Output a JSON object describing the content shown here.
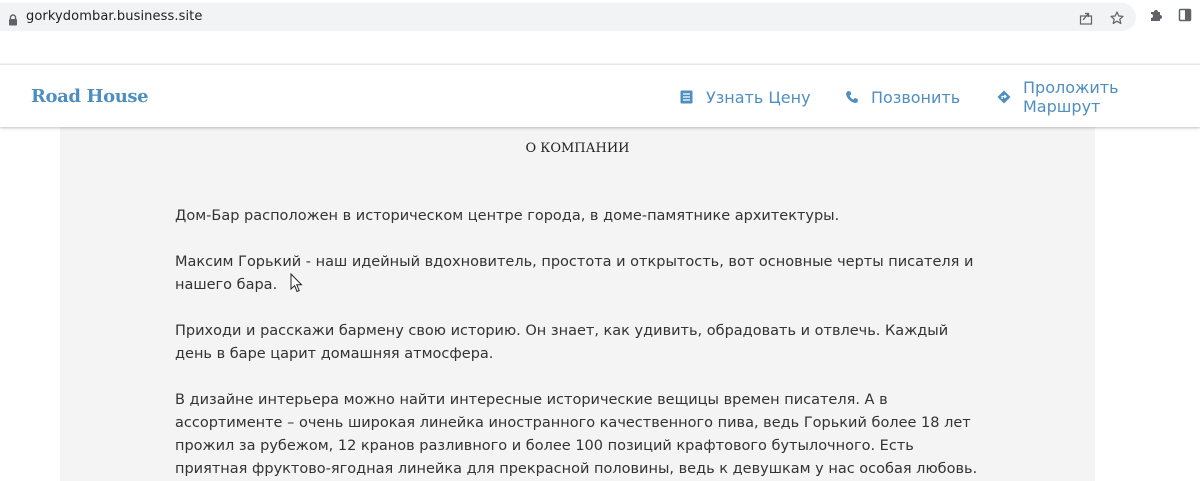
{
  "browser": {
    "url": "gorkydombar.business.site",
    "icons": [
      "lock-icon",
      "share-icon",
      "star-icon",
      "extensions-icon",
      "side-panel-icon"
    ]
  },
  "header": {
    "brand": "Road House",
    "nav": [
      {
        "label": "Узнать Цену",
        "icon": "price-list-icon"
      },
      {
        "label": "Позвонить",
        "icon": "phone-icon"
      },
      {
        "label": "Проложить Маршрут",
        "icon": "directions-icon"
      }
    ]
  },
  "about": {
    "title": "О КОМПАНИИ",
    "paragraphs": [
      "Дом-Бар расположен в историческом центре города, в доме-памятнике архитектуры.",
      "Максим Горький - наш идейный вдохновитель, простота и открытость, вот основные черты писателя и нашего бара.",
      "Приходи и расскажи бармену свою историю. Он знает, как удивить, обрадовать и отвлечь. Каждый день в баре царит домашняя атмосфера.",
      "В дизайне интерьера можно найти интересные исторические вещицы времен писателя. А в ассортименте – очень широкая линейка иностранного качественного пива, ведь Горький более 18 лет прожил за рубежом, 12 кранов разливного и более 100 позиций крафтового бутылочного. Есть приятная фруктово-ягодная линейка для прекрасной половины, ведь к девушкам у нас особая любовь."
    ]
  },
  "colors": {
    "brand": "#4f8fc0",
    "panel": "#f4f4f4",
    "text": "#333333"
  }
}
